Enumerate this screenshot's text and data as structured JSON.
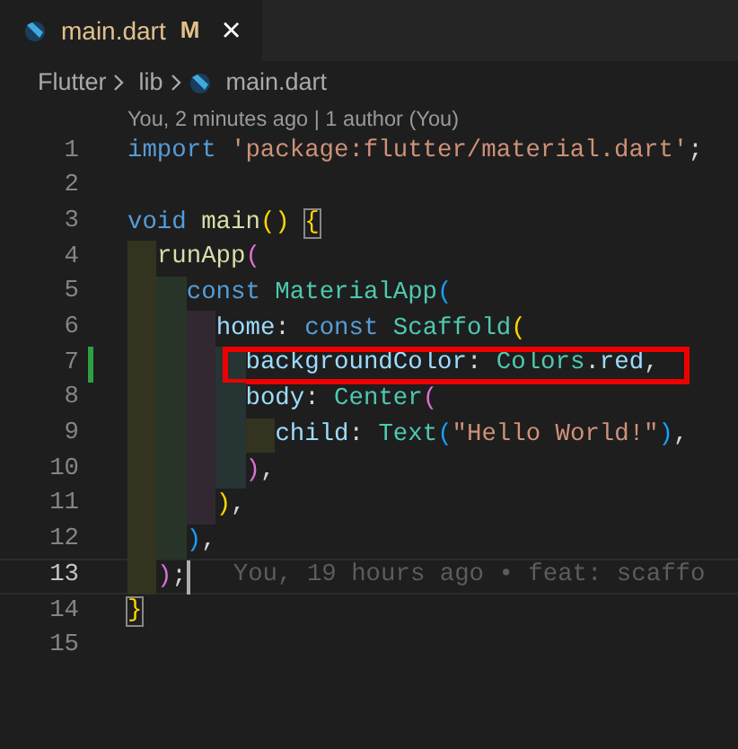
{
  "tab": {
    "title": "main.dart",
    "status": "M",
    "close": "×",
    "selected": true
  },
  "breadcrumb": [
    "Flutter",
    "lib",
    "main.dart"
  ],
  "codelens": "You, 2 minutes ago | 1 author (You)",
  "lines": [
    {
      "number": "1",
      "tokens": [
        {
          "text": "import ",
          "kind": "kw"
        },
        {
          "text": "'package:flutter/material.dart'",
          "kind": "str"
        },
        {
          "text": ";",
          "kind": "plain"
        }
      ]
    },
    {
      "number": "2"
    },
    {
      "number": "3",
      "tokens": [
        {
          "text": "void ",
          "kind": "kw"
        },
        {
          "text": "main",
          "kind": "fn"
        },
        {
          "text": "() ",
          "kind": "b1"
        },
        {
          "text": "{",
          "kind": "b1",
          "matched": true
        }
      ]
    },
    {
      "number": "4",
      "guides": [
        {
          "color": "#33331f"
        }
      ],
      "tokens": [
        {
          "text": "runApp",
          "kind": "fn"
        },
        {
          "text": "(",
          "kind": "b2"
        }
      ]
    },
    {
      "number": "5",
      "guides": [
        {
          "color": "#33331f"
        },
        {
          "color": "#283428"
        }
      ],
      "tokens": [
        {
          "text": "const ",
          "kind": "kw"
        },
        {
          "text": "MaterialApp",
          "kind": "type"
        },
        {
          "text": "(",
          "kind": "b3"
        }
      ]
    },
    {
      "number": "6",
      "guides": [
        {
          "color": "#33331f"
        },
        {
          "color": "#283428"
        },
        {
          "color": "#322832"
        }
      ],
      "tokens": [
        {
          "text": "home",
          "kind": "var"
        },
        {
          "text": ": ",
          "kind": "plain"
        },
        {
          "text": "const ",
          "kind": "kw"
        },
        {
          "text": "Scaffold",
          "kind": "type"
        },
        {
          "text": "(",
          "kind": "b1"
        }
      ]
    },
    {
      "number": "7",
      "modified": true,
      "highlighted": true,
      "guides": [
        {
          "color": "#33331f"
        },
        {
          "color": "#283428"
        },
        {
          "color": "#322832"
        },
        {
          "color": "#263434"
        }
      ],
      "tokens": [
        {
          "text": "backgroundColor",
          "kind": "var"
        },
        {
          "text": ": ",
          "kind": "plain"
        },
        {
          "text": "Colors",
          "kind": "type"
        },
        {
          "text": ".",
          "kind": "plain"
        },
        {
          "text": "red",
          "kind": "var"
        },
        {
          "text": ",",
          "kind": "plain"
        }
      ]
    },
    {
      "number": "8",
      "guides": [
        {
          "color": "#33331f"
        },
        {
          "color": "#283428"
        },
        {
          "color": "#322832"
        },
        {
          "color": "#263434"
        }
      ],
      "tokens": [
        {
          "text": "body",
          "kind": "var"
        },
        {
          "text": ": ",
          "kind": "plain"
        },
        {
          "text": "Center",
          "kind": "type"
        },
        {
          "text": "(",
          "kind": "b2"
        }
      ]
    },
    {
      "number": "9",
      "guides": [
        {
          "color": "#33331f"
        },
        {
          "color": "#283428"
        },
        {
          "color": "#322832"
        },
        {
          "color": "#263434"
        },
        {
          "color": "#33331f"
        }
      ],
      "tokens": [
        {
          "text": "child",
          "kind": "var"
        },
        {
          "text": ": ",
          "kind": "plain"
        },
        {
          "text": "Text",
          "kind": "type"
        },
        {
          "text": "(",
          "kind": "b3"
        },
        {
          "text": "\"Hello World!\"",
          "kind": "str"
        },
        {
          "text": ")",
          "kind": "b3"
        },
        {
          "text": ",",
          "kind": "plain"
        }
      ]
    },
    {
      "number": "10",
      "guides": [
        {
          "color": "#33331f"
        },
        {
          "color": "#283428"
        },
        {
          "color": "#322832"
        },
        {
          "color": "#263434"
        }
      ],
      "tokens": [
        {
          "text": ")",
          "kind": "b2"
        },
        {
          "text": ",",
          "kind": "plain"
        }
      ]
    },
    {
      "number": "11",
      "guides": [
        {
          "color": "#33331f"
        },
        {
          "color": "#283428"
        },
        {
          "color": "#322832"
        }
      ],
      "tokens": [
        {
          "text": ")",
          "kind": "b1"
        },
        {
          "text": ",",
          "kind": "plain"
        }
      ]
    },
    {
      "number": "12",
      "guides": [
        {
          "color": "#33331f"
        },
        {
          "color": "#283428"
        }
      ],
      "tokens": [
        {
          "text": ")",
          "kind": "b3"
        },
        {
          "text": ",",
          "kind": "plain"
        }
      ]
    },
    {
      "number": "13",
      "current": true,
      "blame": "You, 19 hours ago • feat: scaffo",
      "guides": [
        {
          "color": "#33331f"
        }
      ],
      "tokens": [
        {
          "text": ")",
          "kind": "b2"
        },
        {
          "text": ";",
          "kind": "plain"
        }
      ]
    },
    {
      "number": "14",
      "tokens": [
        {
          "text": "}",
          "kind": "b1",
          "matched": true
        }
      ]
    },
    {
      "number": "15"
    }
  ]
}
